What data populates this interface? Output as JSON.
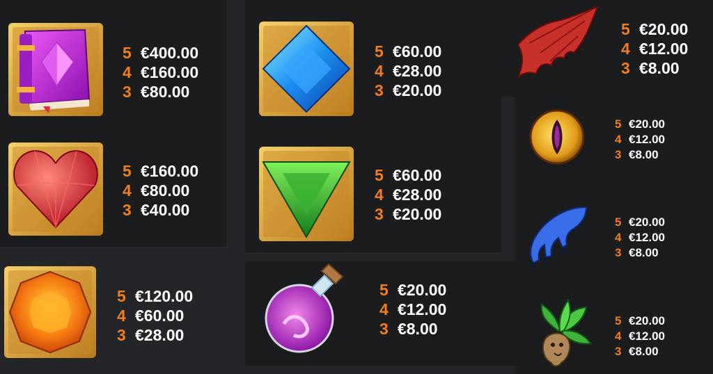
{
  "symbols": [
    {
      "id": "book",
      "icon": "spellbook-icon",
      "pays": [
        {
          "count": "5",
          "amount": "€400.00"
        },
        {
          "count": "4",
          "amount": "€160.00"
        },
        {
          "count": "3",
          "amount": "€80.00"
        }
      ]
    },
    {
      "id": "heart",
      "icon": "red-heart-gem-icon",
      "pays": [
        {
          "count": "5",
          "amount": "€160.00"
        },
        {
          "count": "4",
          "amount": "€80.00"
        },
        {
          "count": "3",
          "amount": "€40.00"
        }
      ]
    },
    {
      "id": "orange",
      "icon": "orange-gem-icon",
      "pays": [
        {
          "count": "5",
          "amount": "€120.00"
        },
        {
          "count": "4",
          "amount": "€60.00"
        },
        {
          "count": "3",
          "amount": "€28.00"
        }
      ]
    },
    {
      "id": "blue",
      "icon": "blue-diamond-gem-icon",
      "pays": [
        {
          "count": "5",
          "amount": "€60.00"
        },
        {
          "count": "4",
          "amount": "€28.00"
        },
        {
          "count": "3",
          "amount": "€20.00"
        }
      ]
    },
    {
      "id": "green",
      "icon": "green-triangle-gem-icon",
      "pays": [
        {
          "count": "5",
          "amount": "€60.00"
        },
        {
          "count": "4",
          "amount": "€28.00"
        },
        {
          "count": "3",
          "amount": "€20.00"
        }
      ]
    },
    {
      "id": "potion",
      "icon": "potion-bottle-icon",
      "pays": [
        {
          "count": "5",
          "amount": "€20.00"
        },
        {
          "count": "4",
          "amount": "€12.00"
        },
        {
          "count": "3",
          "amount": "€8.00"
        }
      ]
    },
    {
      "id": "wing",
      "icon": "dragon-wing-icon",
      "pays": [
        {
          "count": "5",
          "amount": "€20.00"
        },
        {
          "count": "4",
          "amount": "€12.00"
        },
        {
          "count": "3",
          "amount": "€8.00"
        }
      ]
    },
    {
      "id": "eye",
      "icon": "dragon-eye-icon",
      "pays": [
        {
          "count": "5",
          "amount": "€20.00"
        },
        {
          "count": "4",
          "amount": "€12.00"
        },
        {
          "count": "3",
          "amount": "€8.00"
        }
      ]
    },
    {
      "id": "claw",
      "icon": "blue-claw-icon",
      "pays": [
        {
          "count": "5",
          "amount": "€20.00"
        },
        {
          "count": "4",
          "amount": "€12.00"
        },
        {
          "count": "3",
          "amount": "€8.00"
        }
      ]
    },
    {
      "id": "root",
      "icon": "mandrake-root-icon",
      "pays": [
        {
          "count": "5",
          "amount": "€20.00"
        },
        {
          "count": "4",
          "amount": "€12.00"
        },
        {
          "count": "3",
          "amount": "€8.00"
        }
      ]
    }
  ],
  "colors": {
    "background": "#232528",
    "panel": "#1b1c1e",
    "count": "#f07d1f",
    "amount": "#ffffff",
    "gold_tile": "#e0a93a"
  }
}
